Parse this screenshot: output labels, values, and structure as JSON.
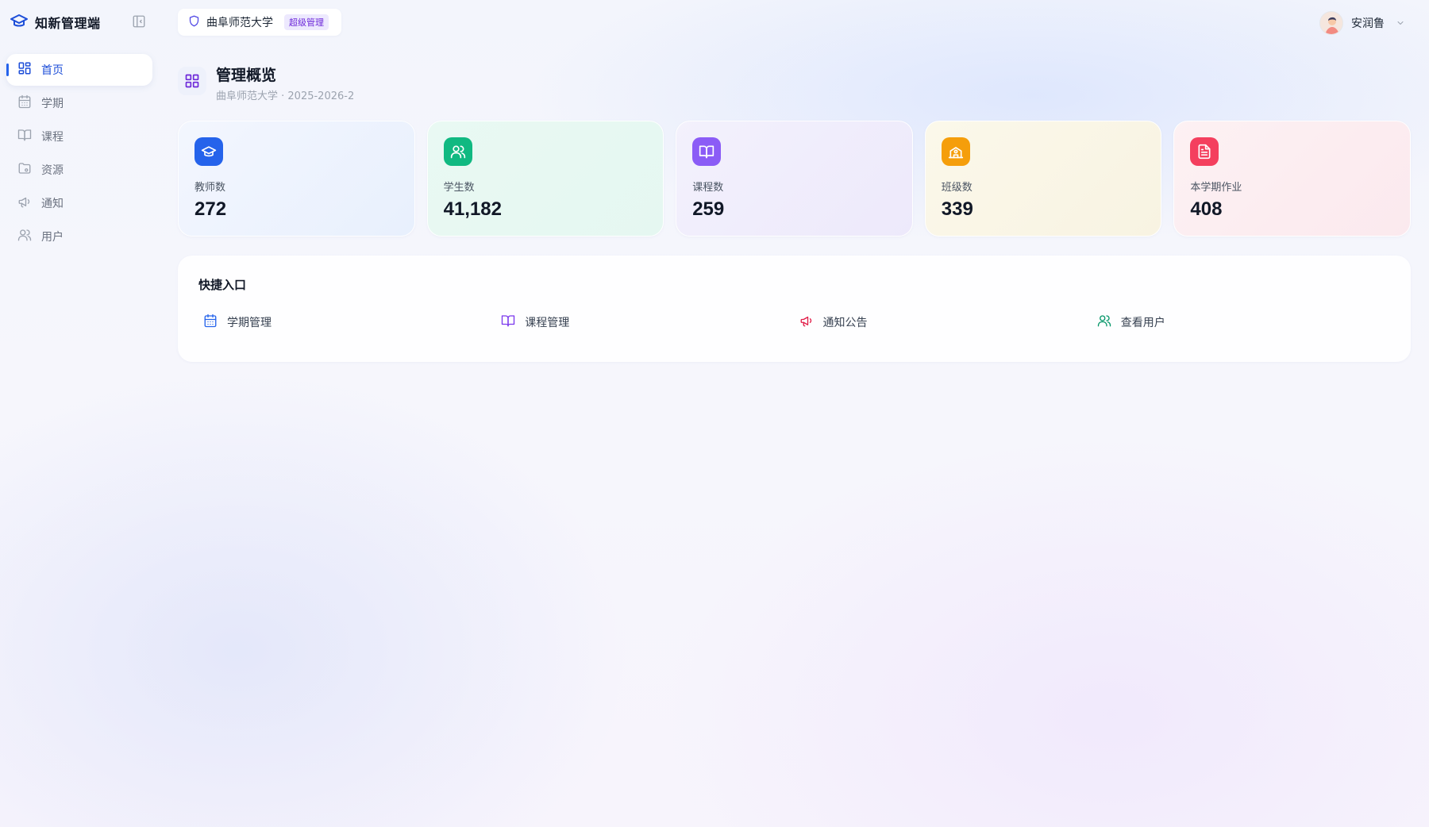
{
  "brand": {
    "title": "知新管理端",
    "icon": "graduation-cap-icon",
    "color": "#1d4ed8"
  },
  "sidebar": {
    "items": [
      {
        "label": "首页",
        "icon": "dashboard-icon",
        "active": true
      },
      {
        "label": "学期",
        "icon": "calendar-icon"
      },
      {
        "label": "课程",
        "icon": "book-open-icon"
      },
      {
        "label": "资源",
        "icon": "folder-icon"
      },
      {
        "label": "通知",
        "icon": "megaphone-icon"
      },
      {
        "label": "用户",
        "icon": "users-icon"
      }
    ]
  },
  "topbar": {
    "org_name": "曲阜师范大学",
    "role_badge": "超级管理",
    "user_name": "安润鲁"
  },
  "page": {
    "title": "管理概览",
    "subtitle": "曲阜师范大学 · 2025-2026-2"
  },
  "stats": [
    {
      "label": "教师数",
      "value": "272",
      "icon": "graduation-cap-icon",
      "color": "#2563eb"
    },
    {
      "label": "学生数",
      "value": "41,182",
      "icon": "users-icon",
      "color": "#10b981"
    },
    {
      "label": "课程数",
      "value": "259",
      "icon": "book-open-icon",
      "color": "#8b5cf6"
    },
    {
      "label": "班级数",
      "value": "339",
      "icon": "school-icon",
      "color": "#f59e0b"
    },
    {
      "label": "本学期作业",
      "value": "408",
      "icon": "file-text-icon",
      "color": "#f43f5e"
    }
  ],
  "quick": {
    "title": "快捷入口",
    "items": [
      {
        "label": "学期管理",
        "icon": "calendar-icon",
        "color": "#2563eb"
      },
      {
        "label": "课程管理",
        "icon": "book-open-icon",
        "color": "#7c3aed"
      },
      {
        "label": "通知公告",
        "icon": "megaphone-icon",
        "color": "#e11d48"
      },
      {
        "label": "查看用户",
        "icon": "users-icon",
        "color": "#059669"
      }
    ]
  }
}
